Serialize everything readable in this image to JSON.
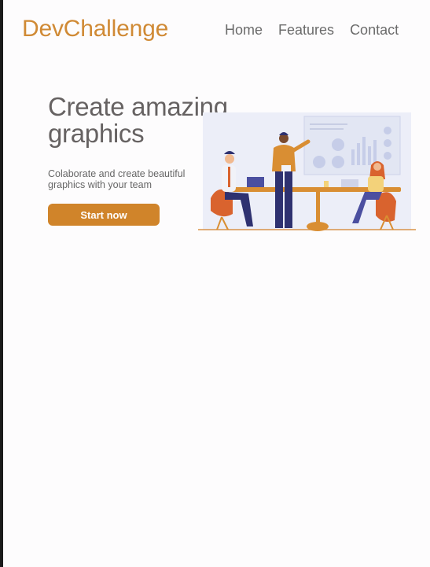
{
  "brand": {
    "name": "DevChallenge"
  },
  "nav": {
    "items": [
      {
        "label": "Home"
      },
      {
        "label": "Features"
      },
      {
        "label": "Contact"
      }
    ]
  },
  "hero": {
    "title": "Create amazing graphics",
    "subtitle": "Colaborate and create beautiful graphics with your team",
    "cta_label": "Start now"
  },
  "illustration": {
    "name": "team-meeting-illustration"
  },
  "colors": {
    "accent": "#d0842a",
    "brand": "#d08a35",
    "text": "#666262",
    "navy": "#2e3170",
    "board": "#e8ecf6"
  }
}
